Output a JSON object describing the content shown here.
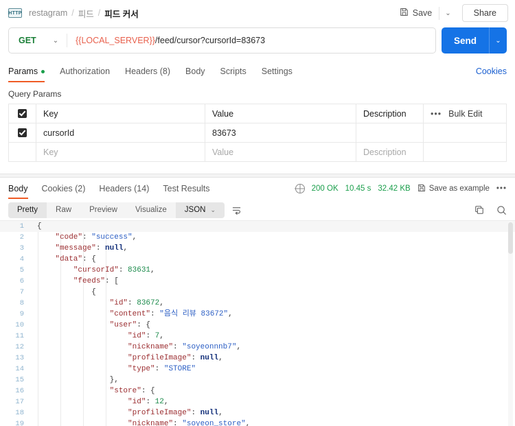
{
  "breadcrumb": {
    "icon": "http-icon",
    "items": [
      "restagram",
      "피드",
      "피드 커서"
    ],
    "separator": "/"
  },
  "topbar": {
    "save_label": "Save",
    "save_icon": "floppy-disk-icon",
    "save_caret": "⌄",
    "share_label": "Share"
  },
  "request": {
    "method": "GET",
    "method_caret": "⌄",
    "url_variable": "{{LOCAL_SERVER}}",
    "url_path": "/feed/cursor?cursorId=83673",
    "send_label": "Send",
    "send_caret": "⌄"
  },
  "request_tabs": {
    "items": [
      {
        "label": "Params",
        "active": true,
        "dot": true
      },
      {
        "label": "Authorization",
        "active": false,
        "dot": false
      },
      {
        "label": "Headers (8)",
        "active": false,
        "dot": false
      },
      {
        "label": "Body",
        "active": false,
        "dot": false
      },
      {
        "label": "Scripts",
        "active": false,
        "dot": false
      },
      {
        "label": "Settings",
        "active": false,
        "dot": false
      }
    ],
    "cookies_link": "Cookies"
  },
  "query_params": {
    "title": "Query Params",
    "columns": [
      "Key",
      "Value",
      "Description"
    ],
    "bulk_edit_label": "Bulk Edit",
    "more_dots": "•••",
    "rows": [
      {
        "checked": true,
        "key": "cursorId",
        "value": "83673",
        "description": ""
      }
    ],
    "placeholder_row": {
      "key": "Key",
      "value": "Value",
      "description": "Description"
    }
  },
  "response_tabs": {
    "items": [
      {
        "label": "Body",
        "active": true
      },
      {
        "label": "Cookies (2)",
        "active": false
      },
      {
        "label": "Headers (14)",
        "active": false
      },
      {
        "label": "Test Results",
        "active": false
      }
    ]
  },
  "response_meta": {
    "globe_icon": "globe-icon",
    "status": "200 OK",
    "time": "10.45 s",
    "size": "32.42 KB",
    "save_example_icon": "floppy-disk-icon",
    "save_example_label": "Save as example",
    "more_dots": "•••"
  },
  "response_toolbar": {
    "views": [
      {
        "label": "Pretty",
        "active": true
      },
      {
        "label": "Raw",
        "active": false
      },
      {
        "label": "Preview",
        "active": false
      },
      {
        "label": "Visualize",
        "active": false
      }
    ],
    "format": "JSON",
    "format_caret": "⌄",
    "wrap_icon": "word-wrap-icon",
    "copy_icon": "copy-icon",
    "search_icon": "search-icon"
  },
  "response_body": {
    "language": "json",
    "lines": [
      {
        "num": 1,
        "indent": 0,
        "tokens": [
          {
            "t": "p",
            "v": "{"
          }
        ]
      },
      {
        "num": 2,
        "indent": 1,
        "tokens": [
          {
            "t": "k",
            "v": "\"code\""
          },
          {
            "t": "p",
            "v": ": "
          },
          {
            "t": "s",
            "v": "\"success\""
          },
          {
            "t": "p",
            "v": ","
          }
        ]
      },
      {
        "num": 3,
        "indent": 1,
        "tokens": [
          {
            "t": "k",
            "v": "\"message\""
          },
          {
            "t": "p",
            "v": ": "
          },
          {
            "t": "nl",
            "v": "null"
          },
          {
            "t": "p",
            "v": ","
          }
        ]
      },
      {
        "num": 4,
        "indent": 1,
        "tokens": [
          {
            "t": "k",
            "v": "\"data\""
          },
          {
            "t": "p",
            "v": ": {"
          }
        ]
      },
      {
        "num": 5,
        "indent": 2,
        "tokens": [
          {
            "t": "k",
            "v": "\"cursorId\""
          },
          {
            "t": "p",
            "v": ": "
          },
          {
            "t": "n",
            "v": "83631"
          },
          {
            "t": "p",
            "v": ","
          }
        ]
      },
      {
        "num": 6,
        "indent": 2,
        "tokens": [
          {
            "t": "k",
            "v": "\"feeds\""
          },
          {
            "t": "p",
            "v": ": ["
          }
        ]
      },
      {
        "num": 7,
        "indent": 3,
        "tokens": [
          {
            "t": "p",
            "v": "{"
          }
        ]
      },
      {
        "num": 8,
        "indent": 4,
        "tokens": [
          {
            "t": "k",
            "v": "\"id\""
          },
          {
            "t": "p",
            "v": ": "
          },
          {
            "t": "n",
            "v": "83672"
          },
          {
            "t": "p",
            "v": ","
          }
        ]
      },
      {
        "num": 9,
        "indent": 4,
        "tokens": [
          {
            "t": "k",
            "v": "\"content\""
          },
          {
            "t": "p",
            "v": ": "
          },
          {
            "t": "s",
            "v": "\"음식 리뷰 83672\""
          },
          {
            "t": "p",
            "v": ","
          }
        ]
      },
      {
        "num": 10,
        "indent": 4,
        "tokens": [
          {
            "t": "k",
            "v": "\"user\""
          },
          {
            "t": "p",
            "v": ": {"
          }
        ]
      },
      {
        "num": 11,
        "indent": 5,
        "tokens": [
          {
            "t": "k",
            "v": "\"id\""
          },
          {
            "t": "p",
            "v": ": "
          },
          {
            "t": "n",
            "v": "7"
          },
          {
            "t": "p",
            "v": ","
          }
        ]
      },
      {
        "num": 12,
        "indent": 5,
        "tokens": [
          {
            "t": "k",
            "v": "\"nickname\""
          },
          {
            "t": "p",
            "v": ": "
          },
          {
            "t": "s",
            "v": "\"soyeonnnb7\""
          },
          {
            "t": "p",
            "v": ","
          }
        ]
      },
      {
        "num": 13,
        "indent": 5,
        "tokens": [
          {
            "t": "k",
            "v": "\"profileImage\""
          },
          {
            "t": "p",
            "v": ": "
          },
          {
            "t": "nl",
            "v": "null"
          },
          {
            "t": "p",
            "v": ","
          }
        ]
      },
      {
        "num": 14,
        "indent": 5,
        "tokens": [
          {
            "t": "k",
            "v": "\"type\""
          },
          {
            "t": "p",
            "v": ": "
          },
          {
            "t": "s",
            "v": "\"STORE\""
          }
        ]
      },
      {
        "num": 15,
        "indent": 4,
        "tokens": [
          {
            "t": "p",
            "v": "},"
          }
        ]
      },
      {
        "num": 16,
        "indent": 4,
        "tokens": [
          {
            "t": "k",
            "v": "\"store\""
          },
          {
            "t": "p",
            "v": ": {"
          }
        ]
      },
      {
        "num": 17,
        "indent": 5,
        "tokens": [
          {
            "t": "k",
            "v": "\"id\""
          },
          {
            "t": "p",
            "v": ": "
          },
          {
            "t": "n",
            "v": "12"
          },
          {
            "t": "p",
            "v": ","
          }
        ]
      },
      {
        "num": 18,
        "indent": 5,
        "tokens": [
          {
            "t": "k",
            "v": "\"profileImage\""
          },
          {
            "t": "p",
            "v": ": "
          },
          {
            "t": "nl",
            "v": "null"
          },
          {
            "t": "p",
            "v": ","
          }
        ]
      },
      {
        "num": 19,
        "indent": 5,
        "tokens": [
          {
            "t": "k",
            "v": "\"nickname\""
          },
          {
            "t": "p",
            "v": ": "
          },
          {
            "t": "s",
            "v": "\"soyeon_store\""
          },
          {
            "t": "p",
            "v": ","
          }
        ]
      }
    ]
  },
  "colors": {
    "accent_orange": "#ef5b25",
    "send_blue": "#1573e6",
    "status_green": "#1a9e4b",
    "method_green": "#1a7f37",
    "link_blue": "#1a5fd0",
    "variable_red": "#e8604c"
  }
}
